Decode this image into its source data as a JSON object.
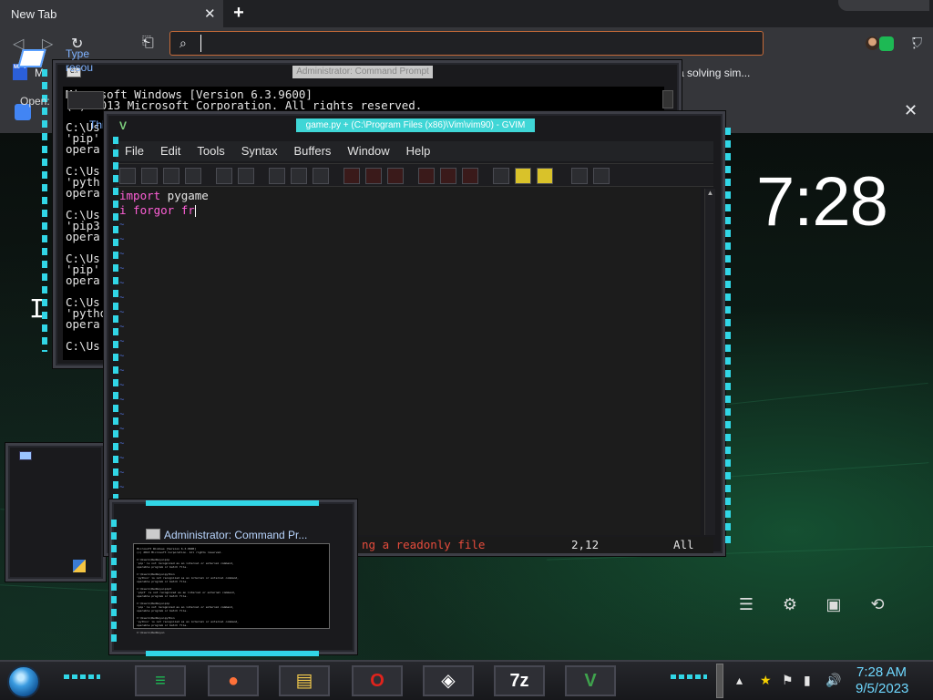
{
  "browser": {
    "tab_title": "New Tab",
    "tab_close": "✕",
    "new_tab": "+",
    "omnibox_placeholder": "",
    "bookmarks_left": "M",
    "bookmarks_right": "a solving sim...",
    "bookmark_icon_label": "MF T",
    "panel_close": "✕"
  },
  "desktop": {
    "clock": "7:28",
    "cursor_glyph": "I"
  },
  "cmd": {
    "title": "Administrator: Command Prompt",
    "lines": [
      "Microsoft Windows [Version 6.3.9600]",
      "(c) 2013 Microsoft Corporation. All rights reserved.",
      "",
      "C:\\Us",
      "'pip'",
      "opera",
      "",
      "C:\\Us",
      "'pyth",
      "opera",
      "",
      "C:\\Us",
      "'pip3",
      "opera",
      "",
      "C:\\Us",
      "'pip'",
      "opera",
      "",
      "C:\\Us",
      "'pytho",
      "opera",
      "",
      "C:\\Us"
    ]
  },
  "gvim": {
    "title": "game.py + (C:\\Program Files (x86)\\Vim\\vim90) - GVIM",
    "menu": [
      "File",
      "Edit",
      "Tools",
      "Syntax",
      "Buffers",
      "Window",
      "Help"
    ],
    "code_line1_kw": "import",
    "code_line1_rest": " pygame",
    "code_line2": "i forgor fr",
    "status_msg": "ng a readonly file",
    "status_pos": "2,12",
    "status_all": "All",
    "tilde": "~"
  },
  "run_dialog": {
    "description": "Type\nresou",
    "open_label": "Open:",
    "footer": "This"
  },
  "thumbnail": {
    "title": "Administrator: Command Pr...",
    "preview": "Microsoft Windows [Version 6.3.9600]\n(c) 2013 Microsoft Corporation. All rights reserved.\n\nC:\\Users\\Redboys>pip\n'pip' is not recognized as an internal or external command,\noperable program or batch file.\n\nC:\\Users\\Redboys>python\n'python' is not recognized as an internal or external command,\noperable program or batch file.\n\nC:\\Users\\Redboys>pip3\n'pip3' is not recognized as an internal or external command,\noperable program or batch file.\n\nC:\\Users\\Redboys>pip\n'pip' is not recognized as an internal or external command,\noperable program or batch file.\n\nC:\\Users\\Redboys>python\n'python' is not recognized as an internal or external command,\noperable program or batch file.\n\nC:\\Users\\Redboys>"
  },
  "taskbar": {
    "time": "7:28 AM",
    "date": "9/5/2023",
    "apps": [
      {
        "name": "spotify-like-notes-app",
        "glyph": "≡",
        "color": "#1db954"
      },
      {
        "name": "firefox",
        "glyph": "●",
        "color": "#ff7139"
      },
      {
        "name": "file-explorer",
        "glyph": "▤",
        "color": "#f2c94c"
      },
      {
        "name": "opera",
        "glyph": "O",
        "color": "#e0231c"
      },
      {
        "name": "unity",
        "glyph": "◈",
        "color": "#ffffff"
      },
      {
        "name": "7zip",
        "glyph": "7z",
        "color": "#ffffff"
      },
      {
        "name": "vim",
        "glyph": "V",
        "color": "#3fa34d"
      }
    ]
  },
  "colors": {
    "accent": "#31d6e6",
    "vim_keyword": "#ff5fd7",
    "vim_tilde": "#4f6fd9",
    "error_red": "#e74c3c"
  }
}
